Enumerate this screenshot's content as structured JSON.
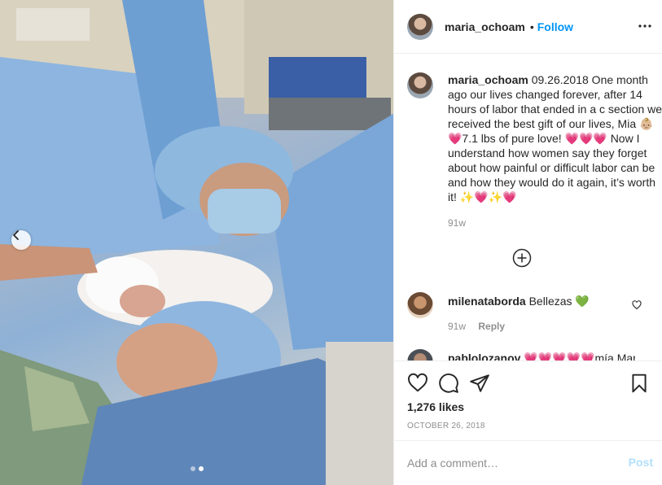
{
  "header": {
    "username": "maria_ochoam",
    "separator": "•",
    "follow_label": "Follow",
    "more_icon": "more-horizontal-icon"
  },
  "caption": {
    "username": "maria_ochoam",
    "text": "09.26.2018 One month ago our lives changed forever, after 14 hours of labor that ended in a c section we received the best gift of our lives, Mia 👶🏼💗7.1 lbs of pure love! 💗💗💗 Now I understand how women say they forget about how painful or difficult labor can be and how they would do it again, it’s worth it! ✨💗✨💗",
    "time": "91w"
  },
  "load_more_icon": "plus-circle-icon",
  "comments": [
    {
      "username": "milenataborda",
      "text": "Bellezas 💚",
      "time": "91w",
      "reply_label": "Reply"
    },
    {
      "username": "pablolozanov",
      "text": "💗💗💗💗💗mía Mari",
      "time": "",
      "reply_label": ""
    }
  ],
  "actions": {
    "like_icon": "heart-icon",
    "comment_icon": "comment-icon",
    "share_icon": "send-icon",
    "save_icon": "bookmark-icon",
    "likes": "1,276 likes",
    "date": "OCTOBER 26, 2018"
  },
  "add_comment": {
    "placeholder": "Add a comment…",
    "post_label": "Post"
  },
  "carousel": {
    "slide_count": 2,
    "active_slide": 2
  },
  "colors": {
    "follow": "#0095f6",
    "post_disabled": "#b2dffc",
    "secondary_text": "#8e8e8e",
    "divider": "#efefef"
  }
}
